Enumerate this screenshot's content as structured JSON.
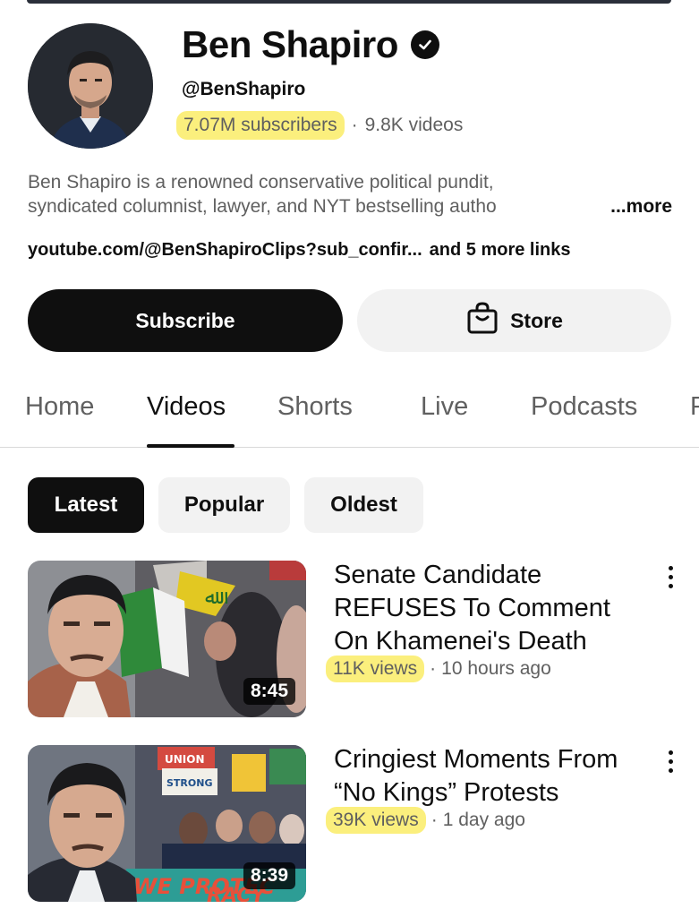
{
  "channel": {
    "name": "Ben Shapiro",
    "handle": "@BenShapiro",
    "subscribers": "7.07M subscribers",
    "separator": "·",
    "videos_count": "9.8K videos",
    "description_line1": "Ben Shapiro is a renowned conservative political pundit,",
    "description_line2": "syndicated columnist, lawyer, and NYT bestselling autho",
    "more_label": "...more",
    "link": "youtube.com/@BenShapiroClips?sub_confir...",
    "more_links": "and 5 more links"
  },
  "actions": {
    "subscribe_label": "Subscribe",
    "store_label": "Store"
  },
  "tabs": [
    {
      "label": "Home"
    },
    {
      "label": "Videos"
    },
    {
      "label": "Shorts"
    },
    {
      "label": "Live"
    },
    {
      "label": "Podcasts"
    },
    {
      "label": "P"
    }
  ],
  "active_tab": "Videos",
  "filters": [
    {
      "label": "Latest"
    },
    {
      "label": "Popular"
    },
    {
      "label": "Oldest"
    }
  ],
  "active_filter": "Latest",
  "videos": [
    {
      "title_lines": [
        "Senate Candidate",
        "REFUSES To Comment",
        "On Khamenei's Death"
      ],
      "views": "11K views",
      "separator": "·",
      "age": "10 hours ago",
      "duration": "8:45",
      "thumb_flag_text": "ﷲ"
    },
    {
      "title_lines": [
        "Cringiest Moments From",
        "“No Kings” Protests"
      ],
      "views": "39K views",
      "separator": "·",
      "age": "1 day ago",
      "duration": "8:39",
      "thumb_sign_1": "UNION",
      "thumb_sign_2": "STRONG",
      "thumb_banner": "WE PROTEC",
      "thumb_banner_2": "RACY"
    }
  ],
  "colors": {
    "highlight": "#fbef7d",
    "primary_text": "#0f0f0f",
    "secondary_text": "#606060",
    "chip_bg": "#f2f2f2"
  },
  "icons": [
    "verified-badge-icon",
    "shopping-bag-icon",
    "more-vert-icon"
  ]
}
